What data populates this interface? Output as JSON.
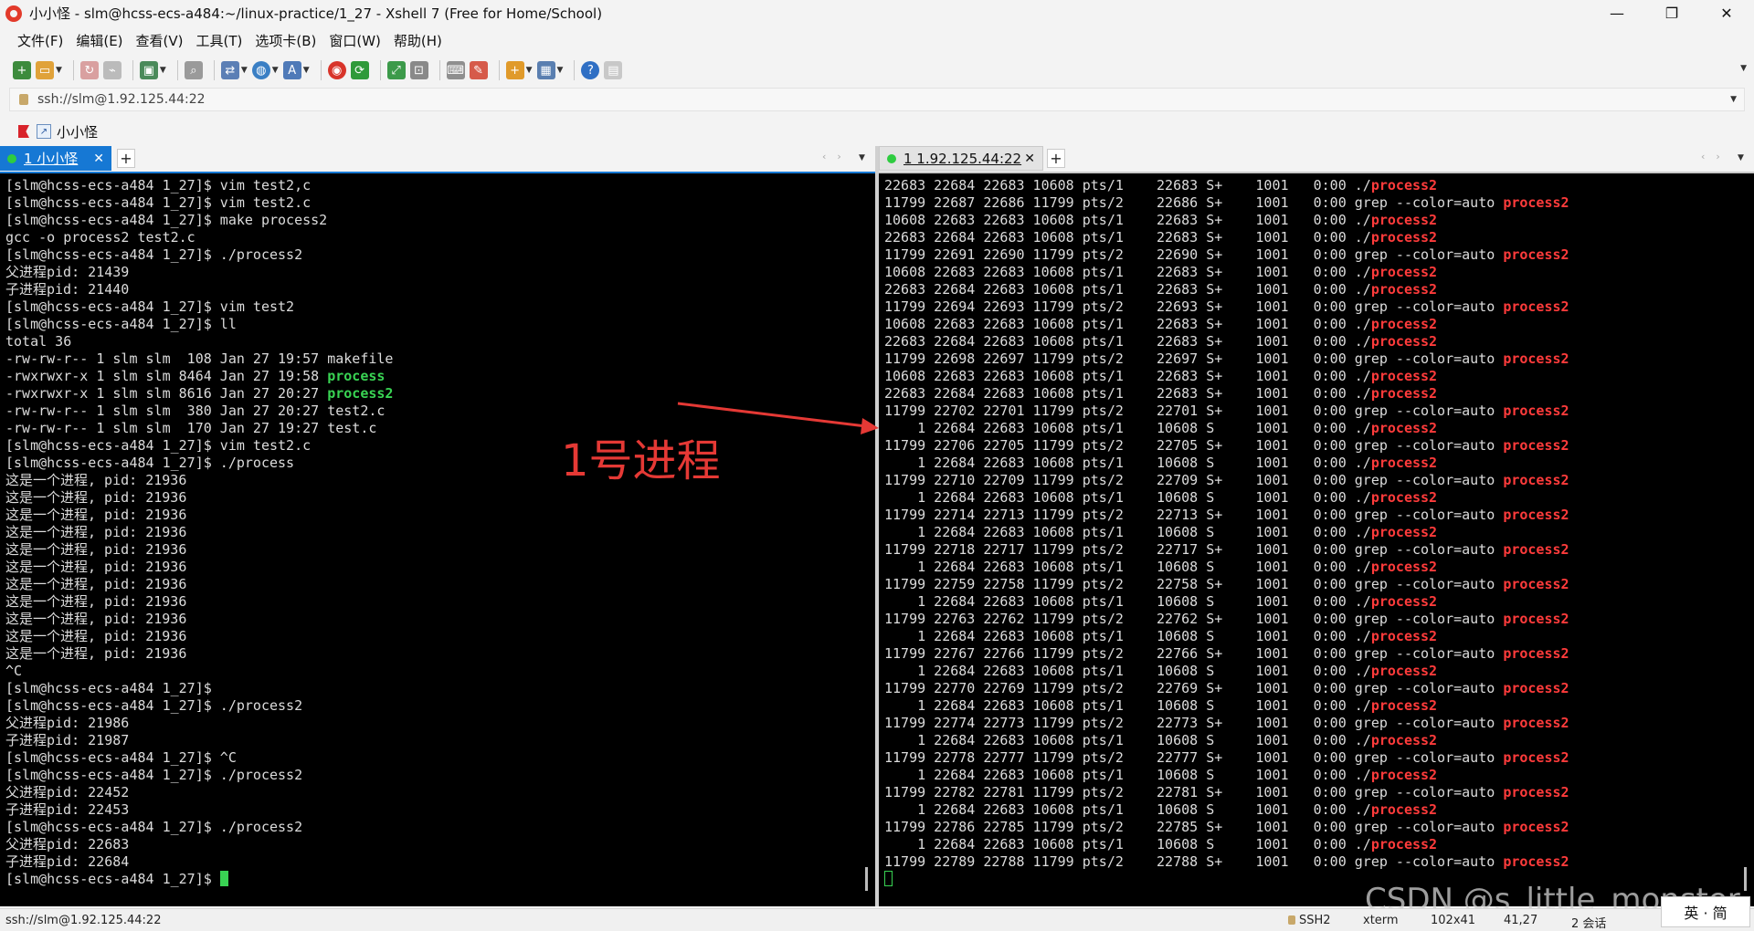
{
  "window": {
    "title": "小小怪 - slm@hcss-ecs-a484:~/linux-practice/1_27 - Xshell 7 (Free for Home/School)",
    "minimize": "—",
    "maximize": "❐",
    "close": "✕"
  },
  "menu": [
    "文件(F)",
    "编辑(E)",
    "查看(V)",
    "工具(T)",
    "选项卡(B)",
    "窗口(W)",
    "帮助(H)"
  ],
  "toolbar": {
    "icons": [
      "new-session-icon",
      "open-folder-icon",
      "reconnect-icon",
      "disconnect-icon",
      "new-window-icon",
      "find-icon",
      "transfer-icon",
      "globe-icon",
      "font-icon",
      "xftp-icon",
      "xmanager-icon",
      "fullscreen-icon",
      "lock-icon",
      "keyboard-icon",
      "highlight-icon",
      "compose-icon",
      "layout-icon",
      "help-icon",
      "chat-icon"
    ]
  },
  "address": {
    "value": "ssh://slm@1.92.125.44:22"
  },
  "quickbar": {
    "label": "小小怪"
  },
  "tabs": {
    "left": {
      "label": "1 小小怪",
      "close": "✕",
      "add": "+"
    },
    "right": {
      "label": "1 1.92.125.44:22",
      "close": "✕",
      "add": "+"
    }
  },
  "colors": {
    "accent": "#1678d4",
    "terminal_bg": "#000000",
    "terminal_fg": "#dcdcdc",
    "exec_green": "#39d353",
    "match_red": "#ff3b3b",
    "annotation_red": "#e53935"
  },
  "left_terminal": [
    [
      {
        "t": "[slm@hcss-ecs-a484 1_27]$ vim test2,c"
      }
    ],
    [
      {
        "t": "[slm@hcss-ecs-a484 1_27]$ vim test2.c"
      }
    ],
    [
      {
        "t": "[slm@hcss-ecs-a484 1_27]$ make process2"
      }
    ],
    [
      {
        "t": "gcc -o process2 test2.c"
      }
    ],
    [
      {
        "t": "[slm@hcss-ecs-a484 1_27]$ ./process2"
      }
    ],
    [
      {
        "t": "父进程pid: 21439"
      }
    ],
    [
      {
        "t": "子进程pid: 21440"
      }
    ],
    [
      {
        "t": "[slm@hcss-ecs-a484 1_27]$ vim test2"
      }
    ],
    [
      {
        "t": "[slm@hcss-ecs-a484 1_27]$ ll"
      }
    ],
    [
      {
        "t": "total 36"
      }
    ],
    [
      {
        "t": "-rw-rw-r-- 1 slm slm  108 Jan 27 19:57 makefile"
      }
    ],
    [
      {
        "t": "-rwxrwxr-x 1 slm slm 8464 Jan 27 19:58 "
      },
      {
        "t": "process",
        "c": "green"
      }
    ],
    [
      {
        "t": "-rwxrwxr-x 1 slm slm 8616 Jan 27 20:27 "
      },
      {
        "t": "process2",
        "c": "green"
      }
    ],
    [
      {
        "t": "-rw-rw-r-- 1 slm slm  380 Jan 27 20:27 test2.c"
      }
    ],
    [
      {
        "t": "-rw-rw-r-- 1 slm slm  170 Jan 27 19:27 test.c"
      }
    ],
    [
      {
        "t": "[slm@hcss-ecs-a484 1_27]$ vim test2.c"
      }
    ],
    [
      {
        "t": "[slm@hcss-ecs-a484 1_27]$ ./process"
      }
    ],
    [
      {
        "t": "这是一个进程, pid: 21936"
      }
    ],
    [
      {
        "t": "这是一个进程, pid: 21936"
      }
    ],
    [
      {
        "t": "这是一个进程, pid: 21936"
      }
    ],
    [
      {
        "t": "这是一个进程, pid: 21936"
      }
    ],
    [
      {
        "t": "这是一个进程, pid: 21936"
      }
    ],
    [
      {
        "t": "这是一个进程, pid: 21936"
      }
    ],
    [
      {
        "t": "这是一个进程, pid: 21936"
      }
    ],
    [
      {
        "t": "这是一个进程, pid: 21936"
      }
    ],
    [
      {
        "t": "这是一个进程, pid: 21936"
      }
    ],
    [
      {
        "t": "这是一个进程, pid: 21936"
      }
    ],
    [
      {
        "t": "这是一个进程, pid: 21936"
      }
    ],
    [
      {
        "t": "^C"
      }
    ],
    [
      {
        "t": "[slm@hcss-ecs-a484 1_27]$"
      }
    ],
    [
      {
        "t": "[slm@hcss-ecs-a484 1_27]$ ./process2"
      }
    ],
    [
      {
        "t": "父进程pid: 21986"
      }
    ],
    [
      {
        "t": "子进程pid: 21987"
      }
    ],
    [
      {
        "t": "[slm@hcss-ecs-a484 1_27]$ ^C"
      }
    ],
    [
      {
        "t": "[slm@hcss-ecs-a484 1_27]$ ./process2"
      }
    ],
    [
      {
        "t": "父进程pid: 22452"
      }
    ],
    [
      {
        "t": "子进程pid: 22453"
      }
    ],
    [
      {
        "t": "[slm@hcss-ecs-a484 1_27]$ ./process2"
      }
    ],
    [
      {
        "t": "父进程pid: 22683"
      }
    ],
    [
      {
        "t": "子进程pid: 22684"
      }
    ],
    [
      {
        "t": "[slm@hcss-ecs-a484 1_27]$ "
      },
      {
        "cursor": "block"
      }
    ]
  ],
  "right_terminal": [
    [
      {
        "t": "22683 22684 22683 10608 pts/1    22683 S+    1001   0:00 ./"
      },
      {
        "t": "process2",
        "c": "red"
      }
    ],
    [
      {
        "t": "11799 22687 22686 11799 pts/2    22686 S+    1001   0:00 grep --color=auto "
      },
      {
        "t": "process2",
        "c": "red"
      }
    ],
    [
      {
        "t": "10608 22683 22683 10608 pts/1    22683 S+    1001   0:00 ./"
      },
      {
        "t": "process2",
        "c": "red"
      }
    ],
    [
      {
        "t": "22683 22684 22683 10608 pts/1    22683 S+    1001   0:00 ./"
      },
      {
        "t": "process2",
        "c": "red"
      }
    ],
    [
      {
        "t": "11799 22691 22690 11799 pts/2    22690 S+    1001   0:00 grep --color=auto "
      },
      {
        "t": "process2",
        "c": "red"
      }
    ],
    [
      {
        "t": "10608 22683 22683 10608 pts/1    22683 S+    1001   0:00 ./"
      },
      {
        "t": "process2",
        "c": "red"
      }
    ],
    [
      {
        "t": "22683 22684 22683 10608 pts/1    22683 S+    1001   0:00 ./"
      },
      {
        "t": "process2",
        "c": "red"
      }
    ],
    [
      {
        "t": "11799 22694 22693 11799 pts/2    22693 S+    1001   0:00 grep --color=auto "
      },
      {
        "t": "process2",
        "c": "red"
      }
    ],
    [
      {
        "t": "10608 22683 22683 10608 pts/1    22683 S+    1001   0:00 ./"
      },
      {
        "t": "process2",
        "c": "red"
      }
    ],
    [
      {
        "t": "22683 22684 22683 10608 pts/1    22683 S+    1001   0:00 ./"
      },
      {
        "t": "process2",
        "c": "red"
      }
    ],
    [
      {
        "t": "11799 22698 22697 11799 pts/2    22697 S+    1001   0:00 grep --color=auto "
      },
      {
        "t": "process2",
        "c": "red"
      }
    ],
    [
      {
        "t": "10608 22683 22683 10608 pts/1    22683 S+    1001   0:00 ./"
      },
      {
        "t": "process2",
        "c": "red"
      }
    ],
    [
      {
        "t": "22683 22684 22683 10608 pts/1    22683 S+    1001   0:00 ./"
      },
      {
        "t": "process2",
        "c": "red"
      }
    ],
    [
      {
        "t": "11799 22702 22701 11799 pts/2    22701 S+    1001   0:00 grep --color=auto "
      },
      {
        "t": "process2",
        "c": "red"
      }
    ],
    [
      {
        "t": "    1 22684 22683 10608 pts/1    10608 S     1001   0:00 ./"
      },
      {
        "t": "process2",
        "c": "red"
      }
    ],
    [
      {
        "t": "11799 22706 22705 11799 pts/2    22705 S+    1001   0:00 grep --color=auto "
      },
      {
        "t": "process2",
        "c": "red"
      }
    ],
    [
      {
        "t": "    1 22684 22683 10608 pts/1    10608 S     1001   0:00 ./"
      },
      {
        "t": "process2",
        "c": "red"
      }
    ],
    [
      {
        "t": "11799 22710 22709 11799 pts/2    22709 S+    1001   0:00 grep --color=auto "
      },
      {
        "t": "process2",
        "c": "red"
      }
    ],
    [
      {
        "t": "    1 22684 22683 10608 pts/1    10608 S     1001   0:00 ./"
      },
      {
        "t": "process2",
        "c": "red"
      }
    ],
    [
      {
        "t": "11799 22714 22713 11799 pts/2    22713 S+    1001   0:00 grep --color=auto "
      },
      {
        "t": "process2",
        "c": "red"
      }
    ],
    [
      {
        "t": "    1 22684 22683 10608 pts/1    10608 S     1001   0:00 ./"
      },
      {
        "t": "process2",
        "c": "red"
      }
    ],
    [
      {
        "t": "11799 22718 22717 11799 pts/2    22717 S+    1001   0:00 grep --color=auto "
      },
      {
        "t": "process2",
        "c": "red"
      }
    ],
    [
      {
        "t": "    1 22684 22683 10608 pts/1    10608 S     1001   0:00 ./"
      },
      {
        "t": "process2",
        "c": "red"
      }
    ],
    [
      {
        "t": "11799 22759 22758 11799 pts/2    22758 S+    1001   0:00 grep --color=auto "
      },
      {
        "t": "process2",
        "c": "red"
      }
    ],
    [
      {
        "t": "    1 22684 22683 10608 pts/1    10608 S     1001   0:00 ./"
      },
      {
        "t": "process2",
        "c": "red"
      }
    ],
    [
      {
        "t": "11799 22763 22762 11799 pts/2    22762 S+    1001   0:00 grep --color=auto "
      },
      {
        "t": "process2",
        "c": "red"
      }
    ],
    [
      {
        "t": "    1 22684 22683 10608 pts/1    10608 S     1001   0:00 ./"
      },
      {
        "t": "process2",
        "c": "red"
      }
    ],
    [
      {
        "t": "11799 22767 22766 11799 pts/2    22766 S+    1001   0:00 grep --color=auto "
      },
      {
        "t": "process2",
        "c": "red"
      }
    ],
    [
      {
        "t": "    1 22684 22683 10608 pts/1    10608 S     1001   0:00 ./"
      },
      {
        "t": "process2",
        "c": "red"
      }
    ],
    [
      {
        "t": "11799 22770 22769 11799 pts/2    22769 S+    1001   0:00 grep --color=auto "
      },
      {
        "t": "process2",
        "c": "red"
      }
    ],
    [
      {
        "t": "    1 22684 22683 10608 pts/1    10608 S     1001   0:00 ./"
      },
      {
        "t": "process2",
        "c": "red"
      }
    ],
    [
      {
        "t": "11799 22774 22773 11799 pts/2    22773 S+    1001   0:00 grep --color=auto "
      },
      {
        "t": "process2",
        "c": "red"
      }
    ],
    [
      {
        "t": "    1 22684 22683 10608 pts/1    10608 S     1001   0:00 ./"
      },
      {
        "t": "process2",
        "c": "red"
      }
    ],
    [
      {
        "t": "11799 22778 22777 11799 pts/2    22777 S+    1001   0:00 grep --color=auto "
      },
      {
        "t": "process2",
        "c": "red"
      }
    ],
    [
      {
        "t": "    1 22684 22683 10608 pts/1    10608 S     1001   0:00 ./"
      },
      {
        "t": "process2",
        "c": "red"
      }
    ],
    [
      {
        "t": "11799 22782 22781 11799 pts/2    22781 S+    1001   0:00 grep --color=auto "
      },
      {
        "t": "process2",
        "c": "red"
      }
    ],
    [
      {
        "t": "    1 22684 22683 10608 pts/1    10608 S     1001   0:00 ./"
      },
      {
        "t": "process2",
        "c": "red"
      }
    ],
    [
      {
        "t": "11799 22786 22785 11799 pts/2    22785 S+    1001   0:00 grep --color=auto "
      },
      {
        "t": "process2",
        "c": "red"
      }
    ],
    [
      {
        "t": "    1 22684 22683 10608 pts/1    10608 S     1001   0:00 ./"
      },
      {
        "t": "process2",
        "c": "red"
      }
    ],
    [
      {
        "t": "11799 22789 22788 11799 pts/2    22788 S+    1001   0:00 grep --color=auto "
      },
      {
        "t": "process2",
        "c": "red"
      }
    ],
    [
      {
        "cursor": "outline"
      }
    ]
  ],
  "annotation": {
    "text": "1号进程"
  },
  "watermark": "CSDN @s_little_monster_",
  "statusbar": {
    "connection": "ssh://slm@1.92.125.44:22",
    "protocol": "SSH2",
    "terminal": "xterm",
    "size": "102x41",
    "cursor_pos": "41,27",
    "sessions": "2 会话",
    "ime": "英 · 简"
  }
}
